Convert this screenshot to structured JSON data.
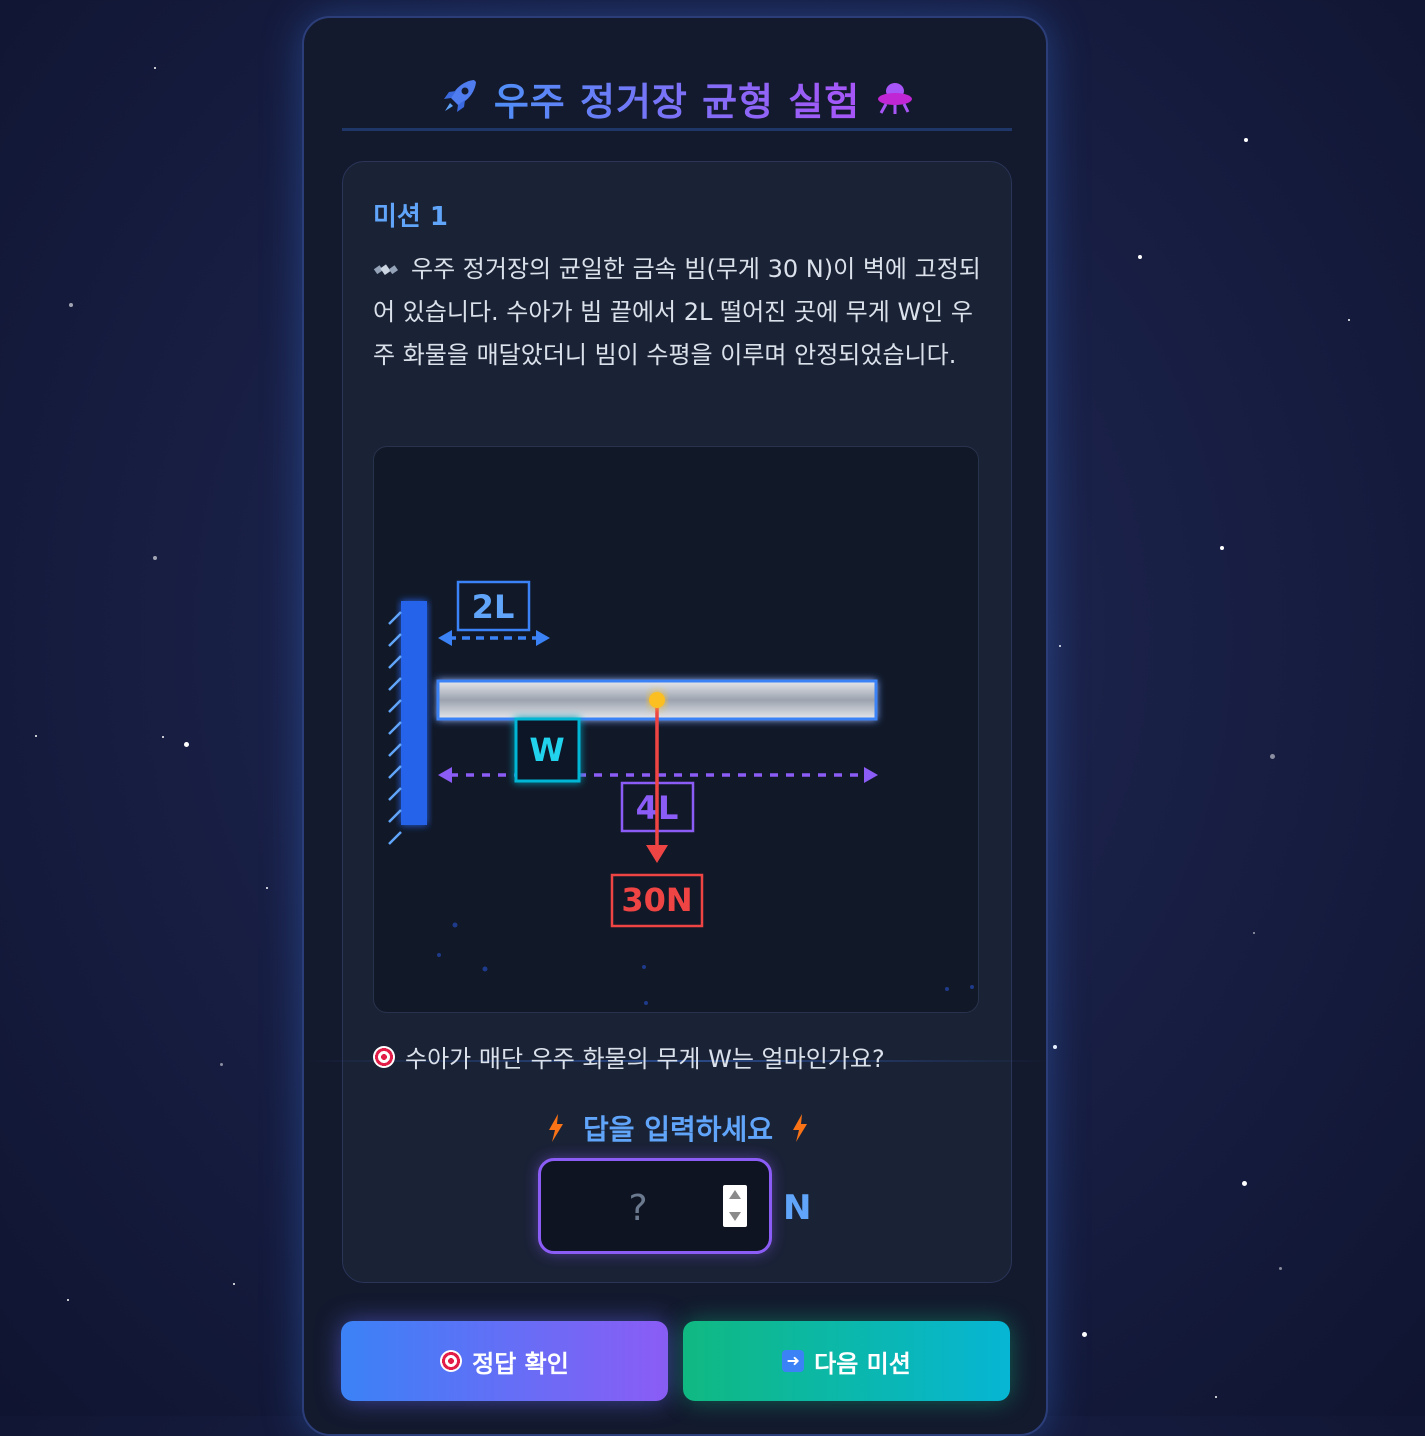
{
  "header": {
    "title": "우주 정거장 균형 실험",
    "left_icon": "rocket-icon",
    "right_icon": "ufo-icon"
  },
  "mission": {
    "label": "미션 1",
    "description": "우주 정거장의 균일한 금속 빔(무게 30 N)이 벽에 고정되어 있습니다. 수아가 빔 끝에서 2L 떨어진 곳에 무게 W인 우주 화물을 매달았더니 빔이 수평을 이루며 안정되었습니다.",
    "description_icon": "satellite-icon"
  },
  "diagram": {
    "distance_short": "2L",
    "distance_long": "4L",
    "weight_label": "W",
    "beam_weight": "30N",
    "colors": {
      "short": "#3b82f6",
      "long": "#8b5cf6",
      "weight": "#22d3ee",
      "force": "#ef4444",
      "center": "#fbbf24"
    }
  },
  "question": {
    "text": "수아가 매단 우주 화물의 무게 W는 얼마인가요?",
    "icon": "target-icon"
  },
  "answer": {
    "label": "답을 입력하세요",
    "placeholder": "?",
    "value": "",
    "unit": "N",
    "icon": "lightning-icon"
  },
  "buttons": {
    "check": "정답 확인",
    "next": "다음 미션"
  }
}
